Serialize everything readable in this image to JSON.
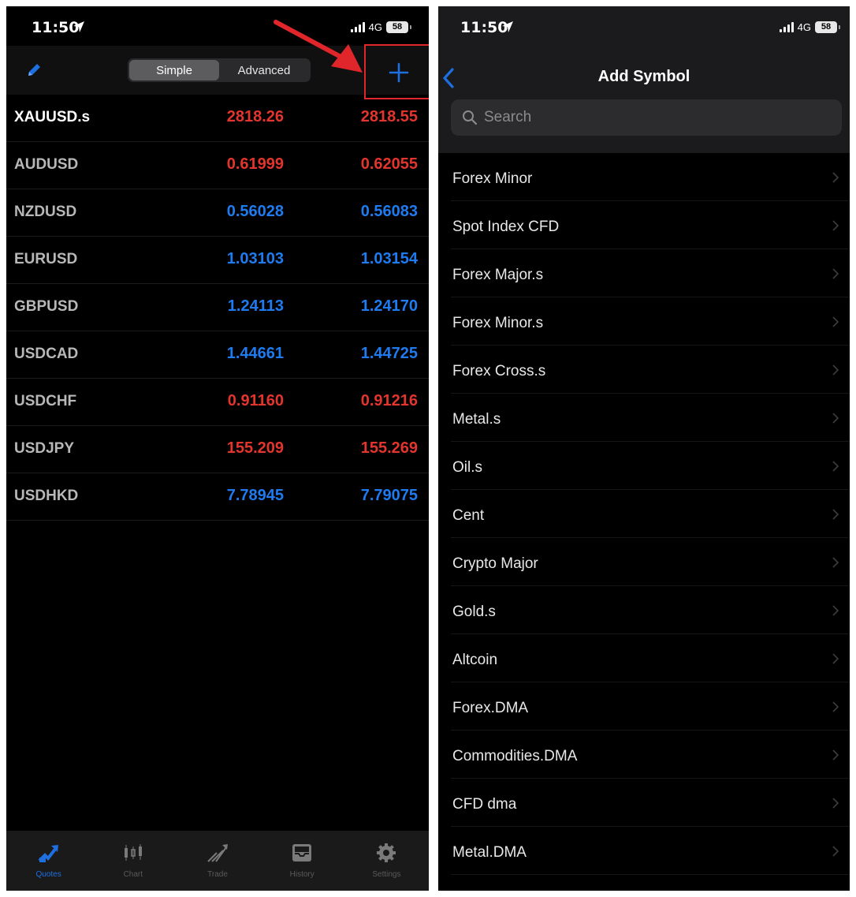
{
  "left": {
    "status": {
      "time": "11:50",
      "network": "4G",
      "battery": "58"
    },
    "segment": {
      "simple": "Simple",
      "advanced": "Advanced"
    },
    "add_symbol": "+",
    "quotes": [
      {
        "symbol": "XAUUSD.s",
        "bid": "2818.26",
        "ask": "2818.55",
        "color": "#e2352d"
      },
      {
        "symbol": "AUDUSD",
        "bid": "0.61999",
        "ask": "0.62055",
        "color": "#e2352d"
      },
      {
        "symbol": "NZDUSD",
        "bid": "0.56028",
        "ask": "0.56083",
        "color": "#1f7bf0"
      },
      {
        "symbol": "EURUSD",
        "bid": "1.03103",
        "ask": "1.03154",
        "color": "#1f7bf0"
      },
      {
        "symbol": "GBPUSD",
        "bid": "1.24113",
        "ask": "1.24170",
        "color": "#1f7bf0"
      },
      {
        "symbol": "USDCAD",
        "bid": "1.44661",
        "ask": "1.44725",
        "color": "#1f7bf0"
      },
      {
        "symbol": "USDCHF",
        "bid": "0.91160",
        "ask": "0.91216",
        "color": "#e2352d"
      },
      {
        "symbol": "USDJPY",
        "bid": "155.209",
        "ask": "155.269",
        "color": "#e2352d"
      },
      {
        "symbol": "USDHKD",
        "bid": "7.78945",
        "ask": "7.79075",
        "color": "#1f7bf0"
      }
    ],
    "tabs": [
      {
        "label": "Quotes",
        "icon": "quotes-icon"
      },
      {
        "label": "Chart",
        "icon": "chart-icon"
      },
      {
        "label": "Trade",
        "icon": "trade-icon"
      },
      {
        "label": "History",
        "icon": "history-icon"
      },
      {
        "label": "Settings",
        "icon": "settings-icon"
      }
    ]
  },
  "right": {
    "status": {
      "time": "11:50",
      "network": "4G",
      "battery": "58"
    },
    "title": "Add Symbol",
    "search_placeholder": "Search",
    "groups": [
      "Forex Minor",
      "Spot Index CFD",
      "Forex Major.s",
      "Forex Minor.s",
      "Forex Cross.s",
      "Metal.s",
      "Oil.s",
      "Cent",
      "Crypto Major",
      "Gold.s",
      "Altcoin",
      "Forex.DMA",
      "Commodities.DMA",
      "CFD dma",
      "Metal.DMA"
    ]
  },
  "colors": {
    "accent": "#1e6fe0",
    "sell_red": "#e2352d",
    "buy_blue": "#1f7bf0",
    "annotation_red": "#e0262a"
  }
}
